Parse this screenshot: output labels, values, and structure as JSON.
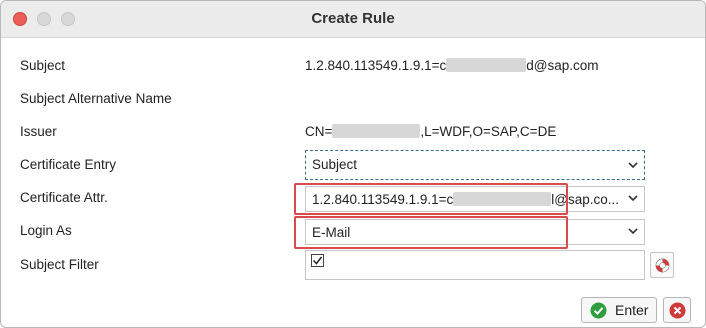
{
  "window": {
    "title": "Create Rule"
  },
  "rows": [
    {
      "label": "Subject",
      "value_prefix": "1.2.840.113549.1.9.1=c",
      "value_suffix": "d@sap.com"
    },
    {
      "label": "Subject Alternative Name",
      "value": ""
    },
    {
      "label": "Issuer",
      "value_prefix": "CN=",
      "value_suffix": ",L=WDF,O=SAP,C=DE"
    },
    {
      "label": "Certificate Entry",
      "value": "Subject"
    },
    {
      "label": "Certificate Attr.",
      "value_prefix": "1.2.840.113549.1.9.1=c",
      "value_suffix": "l@sap.co..."
    },
    {
      "label": "Login As",
      "value": "E-Mail"
    },
    {
      "label": "Subject Filter",
      "checked": true
    }
  ],
  "buttons": {
    "enter": "Enter"
  },
  "icons": {
    "close": "close-window-icon",
    "minimize": "minimize-window-icon",
    "maximize": "maximize-window-icon",
    "dropdown": "chevron-down-icon",
    "checkbox": "checkbox-checked-icon",
    "filter_help": "lifebuoy-icon",
    "enter": "check-circle-icon",
    "cancel": "cancel-x-icon"
  },
  "colors": {
    "highlight": "#d94a4a",
    "focus": "#3c6a8a",
    "ok": "#2e9e3e",
    "cancel": "#d03a3a"
  }
}
